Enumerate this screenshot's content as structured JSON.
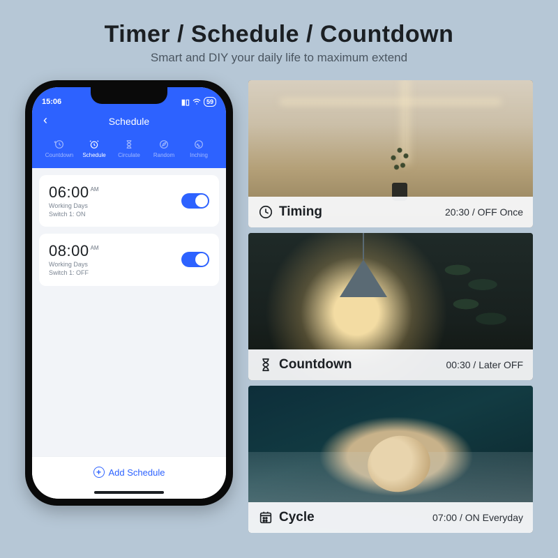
{
  "headline": "Timer / Schedule / Countdown",
  "subhead": "Smart and DIY your daily life to maximum extend",
  "phone": {
    "status_time": "15:06",
    "battery": "59",
    "screen_title": "Schedule",
    "tabs": [
      {
        "label": "Countdown",
        "active": false,
        "icon": "clock-back"
      },
      {
        "label": "Schedule",
        "active": true,
        "icon": "alarm"
      },
      {
        "label": "Circulate",
        "active": false,
        "icon": "hourglass"
      },
      {
        "label": "Random",
        "active": false,
        "icon": "compass"
      },
      {
        "label": "Inching",
        "active": false,
        "icon": "pulse"
      }
    ],
    "schedules": [
      {
        "time": "06:00",
        "ampm": "AM",
        "line1": "Working Days",
        "line2": "Switch 1: ON",
        "enabled": true
      },
      {
        "time": "08:00",
        "ampm": "AM",
        "line1": "Working Days",
        "line2": "Switch 1: OFF",
        "enabled": true
      }
    ],
    "add_label": "Add Schedule"
  },
  "panels": [
    {
      "icon": "clock",
      "title": "Timing",
      "value": "20:30 / OFF Once",
      "scene": "kitchen"
    },
    {
      "icon": "hourglass",
      "title": "Countdown",
      "value": "00:30 / Later OFF",
      "scene": "lamp"
    },
    {
      "icon": "calendar",
      "title": "Cycle",
      "value": "07:00 / ON Everyday",
      "scene": "baby"
    }
  ]
}
